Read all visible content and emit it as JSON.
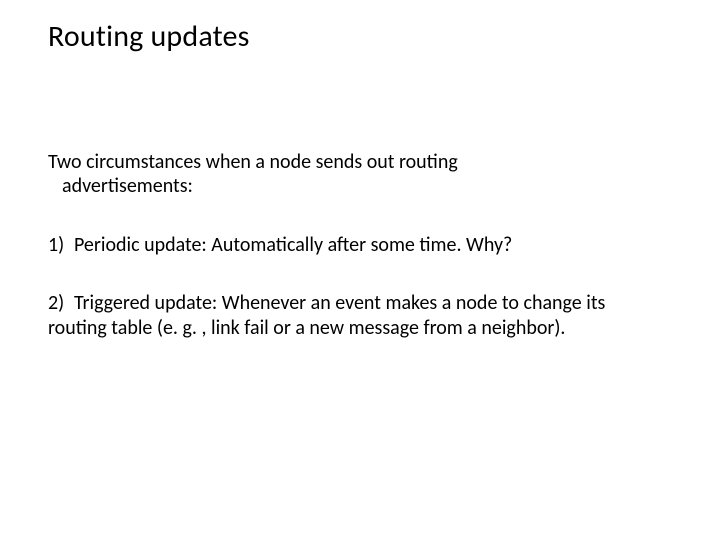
{
  "slide": {
    "title": "Routing updates",
    "intro_line1": "Two circumstances when a node sends out routing",
    "intro_line2": "advertisements:",
    "items": [
      {
        "num": "1)",
        "text": "Periodic update: Automatically after some time. Why?"
      },
      {
        "num": "2)",
        "text": "Triggered update: Whenever an event makes a node to change its routing table (e. g. , link fail or a new message from a neighbor)."
      }
    ]
  }
}
